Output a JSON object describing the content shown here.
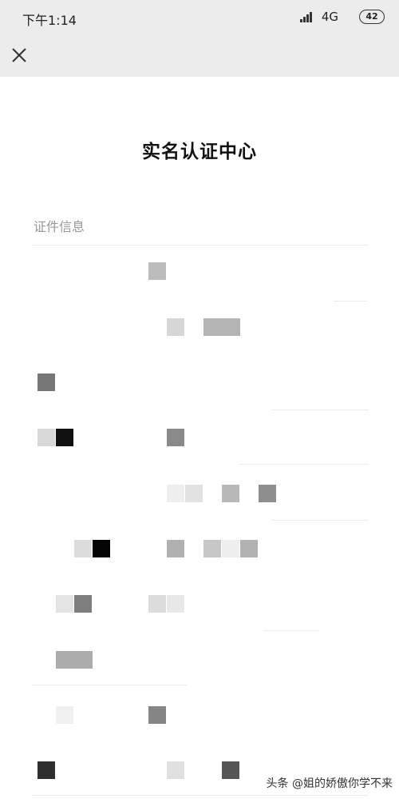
{
  "status_bar": {
    "time": "下午1:14",
    "network": "4G",
    "battery": "42"
  },
  "nav": {
    "close_icon": "close-icon"
  },
  "page": {
    "title": "实名认证中心",
    "section_label": "证件信息"
  },
  "watermark": {
    "text": "头条 @姐的娇傲你学不来"
  }
}
